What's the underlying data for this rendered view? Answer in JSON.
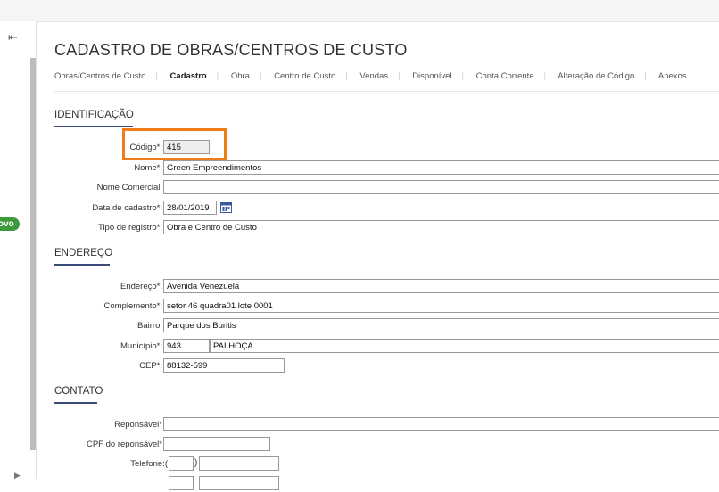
{
  "sidebar": {
    "collapse_icon": "⇤",
    "badge": "ovo"
  },
  "page": {
    "title": "CADASTRO DE OBRAS/CENTROS DE CUSTO"
  },
  "tabs": [
    "Obras/Centros de Custo",
    "Cadastro",
    "Obra",
    "Centro de Custo",
    "Vendas",
    "Disponível",
    "Conta Corrente",
    "Alteração de Código",
    "Anexos"
  ],
  "active_tab": "Cadastro",
  "identificacao": {
    "heading": "IDENTIFICAÇÃO",
    "codigo_label": "Código*:",
    "codigo_value": "415",
    "nome_label": "Nome*:",
    "nome_value": "Green Empreendimentos",
    "nome_comercial_label": "Nome Comercial:",
    "nome_comercial_value": "",
    "data_label": "Data de cadastro*:",
    "data_value": "28/01/2019",
    "tipo_label": "Tipo de registro*:",
    "tipo_value": "Obra e Centro de Custo"
  },
  "endereco": {
    "heading": "ENDEREÇO",
    "endereco_label": "Endereço*:",
    "endereco_value": "Avenida Venezuela",
    "complemento_label": "Complemento*:",
    "complemento_value": "setor 46 quadra01 lote 0001",
    "bairro_label": "Bairro:",
    "bairro_value": "Parque dos Buritis",
    "municipio_label": "Município*:",
    "municipio_code": "943",
    "municipio_name": "PALHOÇA",
    "cep_label": "CEP*:",
    "cep_value": "88132-599"
  },
  "contato": {
    "heading": "CONTATO",
    "responsavel_label": "Reponsável*",
    "responsavel_value": "",
    "cpf_label": "CPF do reponsável*",
    "cpf_value": "",
    "telefone_label": "Telefone:(",
    "telefone_ddd": "",
    "telefone_paren_close": ")",
    "telefone_numero": ""
  },
  "colors": {
    "highlight": "#f07d18",
    "accent": "#3a4a7a",
    "badge": "#3c9a3c"
  }
}
